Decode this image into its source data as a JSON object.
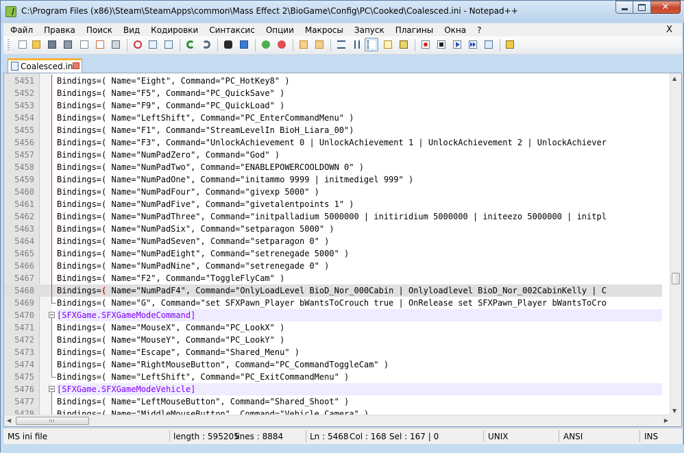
{
  "window": {
    "title": "C:\\Program Files (x86)\\Steam\\SteamApps\\common\\Mass Effect 2\\BioGame\\Config\\PC\\Cooked\\Coalesced.ini - Notepad++",
    "minimize": "minimize",
    "maximize": "maximize",
    "close": "✕"
  },
  "menu": {
    "items": [
      "Файл",
      "Правка",
      "Поиск",
      "Вид",
      "Кодировки",
      "Синтаксис",
      "Опции",
      "Макросы",
      "Запуск",
      "Плагины",
      "Окна",
      "?"
    ],
    "close_doc": "X"
  },
  "toolbar": {
    "icons": [
      "new-file-icon",
      "open-file-icon",
      "save-icon",
      "save-all-icon",
      "close-icon",
      "close-all-icon",
      "print-icon",
      "cut-icon",
      "copy-icon",
      "paste-icon",
      "undo-icon",
      "redo-icon",
      "find-icon",
      "replace-icon",
      "zoom-in-icon",
      "zoom-out-icon",
      "sync-v-icon",
      "sync-h-icon",
      "wrap-icon",
      "all-chars-icon",
      "indent-guide-icon",
      "doc-map-icon",
      "function-list-icon",
      "record-macro-icon",
      "stop-record-icon",
      "play-macro-icon",
      "play-multiple-icon",
      "save-macro-icon",
      "run-icon"
    ]
  },
  "tab": {
    "label": "Coalesced.ini"
  },
  "editor": {
    "current_line": 5468,
    "lines": [
      {
        "n": "5451",
        "t": "Bindings=( Name=\"Eight\", Command=\"PC_HotKey8\" )"
      },
      {
        "n": "5452",
        "t": "Bindings=( Name=\"F5\", Command=\"PC_QuickSave\" )"
      },
      {
        "n": "5453",
        "t": "Bindings=( Name=\"F9\", Command=\"PC_QuickLoad\" )"
      },
      {
        "n": "5454",
        "t": "Bindings=( Name=\"LeftShift\", Command=\"PC_EnterCommandMenu\" )"
      },
      {
        "n": "5455",
        "t": "Bindings=( Name=\"F1\", Command=\"StreamLevelIn BioH_Liara_00\")"
      },
      {
        "n": "5456",
        "t": "Bindings=( Name=\"F3\", Command=\"UnlockAchievement 0 | UnlockAchievement 1 | UnlockAchievement 2 | UnlockAchiever"
      },
      {
        "n": "5457",
        "t": "Bindings=( Name=\"NumPadZero\", Command=\"God\" )"
      },
      {
        "n": "5458",
        "t": "Bindings=( Name=\"NumPadTwo\", Command=\"ENABLEPOWERCOOLDOWN 0\" )"
      },
      {
        "n": "5459",
        "t": "Bindings=( Name=\"NumPadOne\", Command=\"initammo 9999 | initmedigel 999\" )"
      },
      {
        "n": "5460",
        "t": "Bindings=( Name=\"NumPadFour\", Command=\"givexp 5000\" )"
      },
      {
        "n": "5461",
        "t": "Bindings=( Name=\"NumPadFive\", Command=\"givetalentpoints 1\" )"
      },
      {
        "n": "5462",
        "t": "Bindings=( Name=\"NumPadThree\", Command=\"initpalladium 5000000 | initiridium 5000000 | initeezo 5000000 | initpl"
      },
      {
        "n": "5463",
        "t": "Bindings=( Name=\"NumPadSix\", Command=\"setparagon 5000\" )"
      },
      {
        "n": "5464",
        "t": "Bindings=( Name=\"NumPadSeven\", Command=\"setparagon 0\" )"
      },
      {
        "n": "5465",
        "t": "Bindings=( Name=\"NumPadEight\", Command=\"setrenegade 5000\" )"
      },
      {
        "n": "5466",
        "t": "Bindings=( Name=\"NumPadNine\", Command=\"setrenegade 0\" )"
      },
      {
        "n": "5467",
        "t": "Bindings=( Name=\"F2\", Command=\"ToggleFlyCam\" )"
      },
      {
        "n": "5468",
        "t": " Name=\"NumPadF4\", Command=\"OnlyLoadLevel BioD_Nor_000Cabin | Onlyloadlevel BioD_Nor_002CabinKelly | C"
      },
      {
        "n": "5469",
        "t": "Bindings=( Name=\"G\", Command=\"set SFXPawn_Player bWantsToCrouch true | OnRelease set SFXPawn_Player bWantsToCro"
      },
      {
        "n": "5470",
        "t": "[SFXGame.SFXGameModeCommand]"
      },
      {
        "n": "5471",
        "t": "Bindings=( Name=\"MouseX\", Command=\"PC_LookX\" )"
      },
      {
        "n": "5472",
        "t": "Bindings=( Name=\"MouseY\", Command=\"PC_LookY\" )"
      },
      {
        "n": "5473",
        "t": "Bindings=( Name=\"Escape\", Command=\"Shared_Menu\" )"
      },
      {
        "n": "5474",
        "t": "Bindings=( Name=\"RightMouseButton\", Command=\"PC_CommandToggleCam\" )"
      },
      {
        "n": "5475",
        "t": "Bindings=( Name=\"LeftShift\", Command=\"PC_ExitCommandMenu\" )"
      },
      {
        "n": "5476",
        "t": "[SFXGame.SFXGameModeVehicle]"
      },
      {
        "n": "5477",
        "t": "Bindings=( Name=\"LeftMouseButton\", Command=\"Shared_Shoot\" )"
      },
      {
        "n": "5478",
        "t": "Bindings=( Name=\"MiddleMouseButton\", Command=\"Vehicle_Camera\" )"
      }
    ],
    "current_prefix": "Bindings=",
    "current_bracket": "("
  },
  "status": {
    "filetype": "MS ini file",
    "length": "length : 595205",
    "lines": "lines : 8884",
    "ln": "Ln : 5468",
    "col": "Col : 168",
    "sel": "Sel : 167 | 0",
    "eol": "UNIX",
    "encoding": "ANSI",
    "mode": "INS"
  },
  "colors": {
    "section": "#8000ff",
    "current_line": "#e0e0e0",
    "fold_line": "#e03030"
  }
}
